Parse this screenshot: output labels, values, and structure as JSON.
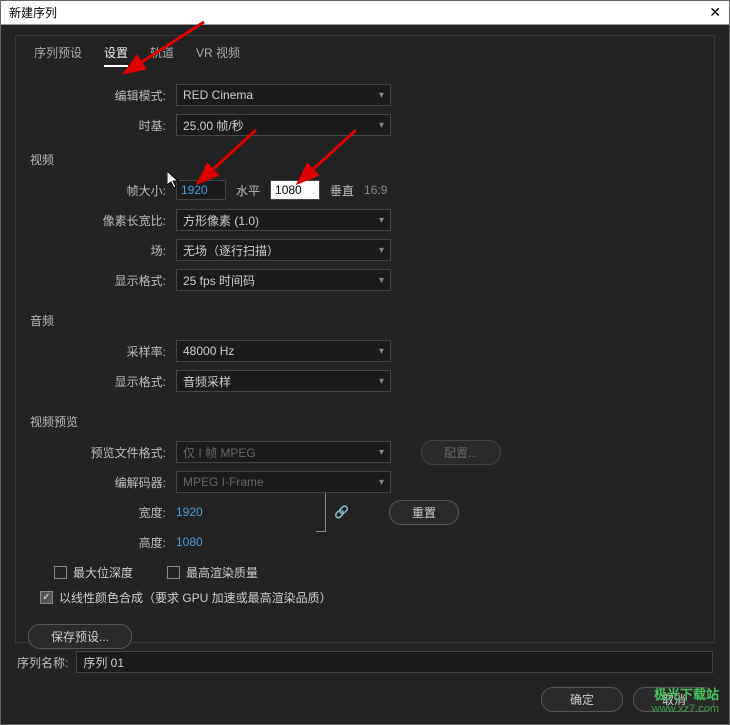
{
  "window": {
    "title": "新建序列"
  },
  "tabs": {
    "preset": "序列预设",
    "settings": "设置",
    "tracks": "轨道",
    "vr": "VR 视频"
  },
  "fields": {
    "editMode": {
      "label": "编辑模式:",
      "value": "RED Cinema"
    },
    "timebase": {
      "label": "时基:",
      "value": "25.00 帧/秒"
    }
  },
  "video": {
    "section": "视频",
    "frameSize": {
      "label": "帧大小:",
      "width": "1920",
      "hLabel": "水平",
      "height": "1080",
      "vLabel": "垂直",
      "ratio": "16:9"
    },
    "pixelAspect": {
      "label": "像素长宽比:",
      "value": "方形像素 (1.0)"
    },
    "fields": {
      "label": "场:",
      "value": "无场（逐行扫描）"
    },
    "displayFormat": {
      "label": "显示格式:",
      "value": "25 fps 时间码"
    }
  },
  "audio": {
    "section": "音频",
    "sampleRate": {
      "label": "采样率:",
      "value": "48000 Hz"
    },
    "displayFormat": {
      "label": "显示格式:",
      "value": "音频采样"
    }
  },
  "preview": {
    "section": "视频预览",
    "fileFormat": {
      "label": "预览文件格式:",
      "value": "仅 I 帧 MPEG"
    },
    "codec": {
      "label": "编解码器:",
      "value": "MPEG I-Frame"
    },
    "width": {
      "label": "宽度:",
      "value": "1920"
    },
    "height": {
      "label": "高度:",
      "value": "1080"
    },
    "configure": "配置...",
    "reset": "重置"
  },
  "checks": {
    "maxBitDepth": "最大位深度",
    "maxRenderQuality": "最高渲染质量",
    "linearComposite": "以线性颜色合成（要求 GPU 加速或最高渲染品质）"
  },
  "savePreset": "保存预设...",
  "sequenceName": {
    "label": "序列名称:",
    "value": "序列 01"
  },
  "buttons": {
    "ok": "确定",
    "cancel": "取消"
  },
  "linkIcon": "🔗",
  "watermark": {
    "line1": "极光下载站",
    "line2": "www.xz7.com"
  }
}
